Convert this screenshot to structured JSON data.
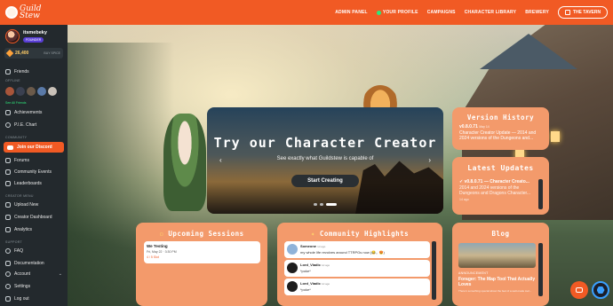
{
  "topbar": {
    "logo_text": "Guild\nStew",
    "nav": [
      "ADMIN PANEL",
      "YOUR PROFILE",
      "CAMPAIGNS",
      "CHARACTER LIBRARY",
      "BREWERY"
    ],
    "tavern_label": "THE TAVERN"
  },
  "sidebar": {
    "username": "itsmebeky",
    "badge": "FOUNDER",
    "coins": "26,400",
    "buy_label": "BUY SPICE",
    "friends_label": "Friends",
    "online_label": "OFFLINE",
    "see_all": "See All Friends",
    "achievements": "Achievements",
    "pie_chart": "P.I.E. Chart",
    "community_section": "COMMUNITY",
    "discord": "Join our Discord",
    "forums": "Forums",
    "community_events": "Community Events",
    "leaderboards": "Leaderboards",
    "creator_section": "CREATOR MENU",
    "upload_new": "Upload New",
    "creator_dashboard": "Creator Dashboard",
    "analytics": "Analytics",
    "support_section": "SUPPORT",
    "faq": "FAQ",
    "documentation": "Documentation",
    "account": "Account",
    "settings": "Settings",
    "logout": "Log out"
  },
  "hero": {
    "title": "Try our Character Creator",
    "subtitle": "See exactly what Guildstew is capable of",
    "button": "Start Creating"
  },
  "version": {
    "title": "Version History",
    "version": "v0.8.0.71",
    "date": "May 14",
    "text": "Character Creator Update — 2014 and 2024 versions of the Dungeons and..."
  },
  "updates": {
    "title": "Latest Updates",
    "headline": "✓ v0.8.0.71 — Character Creato...",
    "text": "2014 and 2024 versions of the Dungeons and Dragons Character...",
    "date": "14 ago"
  },
  "sessions": {
    "title": "Upcoming Sessions",
    "item_title": "We Testing",
    "item_date": "Fri, May 22 · 3:30 PM",
    "item_meta": "4 / 5 Slot"
  },
  "highlights": {
    "title": "Community Highlights",
    "posts": [
      {
        "user": "Someone",
        "time": "1d ago",
        "text": "my whole life revolves around TTRPGs now (😂,, 😍)"
      },
      {
        "user": "Lord_Viadic",
        "time": "1d ago",
        "text": "*poke*"
      },
      {
        "user": "Lord_Viadic",
        "time": "1d ago",
        "text": "*poke*"
      }
    ]
  },
  "blog": {
    "title": "Blog",
    "tag": "ANNOUNCEMENT",
    "headline": "Forager: The Map Tool That Actually Loves",
    "text": "There's something special about the feel of a well-made tool..."
  },
  "colors": {
    "accent": "#f15a24",
    "card": "#f39a6b",
    "sidebar": "#23292d"
  }
}
